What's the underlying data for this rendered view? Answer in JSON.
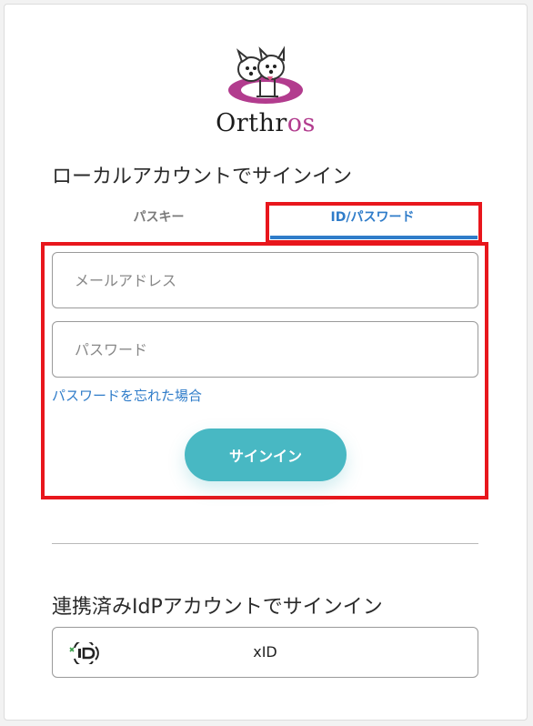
{
  "logo": {
    "prefix": "Orthr",
    "suffix": "os",
    "accent_color": "#b23c8e"
  },
  "local": {
    "title": "ローカルアカウントでサインイン",
    "tabs": [
      {
        "label": "パスキー",
        "active": false
      },
      {
        "label": "ID/パスワード",
        "active": true
      }
    ],
    "email_placeholder": "メールアドレス",
    "email_value": "",
    "password_placeholder": "パスワード",
    "password_value": "",
    "forgot_link": "パスワードを忘れた場合",
    "signin_button": "サインイン"
  },
  "federated": {
    "title": "連携済みIdPアカウントでサインイン",
    "providers": [
      {
        "label": "xID",
        "icon": "xid-logo-icon"
      }
    ]
  },
  "colors": {
    "accent_blue": "#2f7cc9",
    "button_teal": "#48b8c3",
    "highlight_red": "#e8161c"
  }
}
